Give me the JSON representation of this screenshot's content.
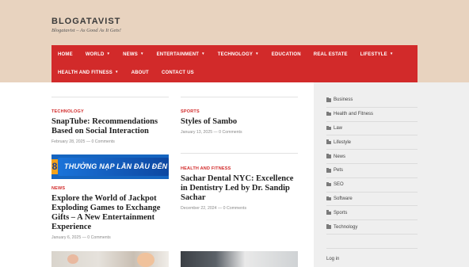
{
  "site": {
    "title": "BLOGATAVIST",
    "tagline": "Blogatavist – As Good As It Gets!"
  },
  "nav": {
    "row1": [
      {
        "label": "HOME",
        "has_dropdown": false
      },
      {
        "label": "WORLD",
        "has_dropdown": true
      },
      {
        "label": "NEWS",
        "has_dropdown": true
      },
      {
        "label": "ENTERTAINMENT",
        "has_dropdown": true
      },
      {
        "label": "TECHNOLOGY",
        "has_dropdown": true
      },
      {
        "label": "EDUCATION",
        "has_dropdown": false
      },
      {
        "label": "REAL ESTATE",
        "has_dropdown": false
      },
      {
        "label": "LIFESTYLE",
        "has_dropdown": true
      }
    ],
    "row2": [
      {
        "label": "HEALTH AND FITNESS",
        "has_dropdown": true
      },
      {
        "label": "ABOUT",
        "has_dropdown": false
      },
      {
        "label": "CONTACT US",
        "has_dropdown": false
      }
    ],
    "caret": "▼",
    "color": "#d22a2a"
  },
  "posts": [
    {
      "category": "TECHNOLOGY",
      "title": "SnapTube: Recommendations Based on Social Interaction",
      "meta": "February 28, 2025 — 0 Comments"
    },
    {
      "category": "SPORTS",
      "title": "Styles of Sambo",
      "meta": "January 13, 2025 — 0 Comments"
    },
    {
      "category": "NEWS",
      "title": "Explore the World of Jackpot Exploding Games to Exchange Gifts – A New Entertainment Experience",
      "meta": "January 6, 2025 — 0 Comments"
    },
    {
      "category": "HEALTH AND FITNESS",
      "title": "Sachar Dental NYC: Excellence in Dentistry Led by Dr. Sandip Sachar",
      "meta": "December 22, 2024 — 0 Comments"
    }
  ],
  "banner": {
    "badge": "8",
    "text": "THƯỞNG NẠP LẦN ĐẦU ĐẾN"
  },
  "sidebar": {
    "categories": [
      "Business",
      "Health and Fitness",
      "Law",
      "Lifestyle",
      "News",
      "Pets",
      "SEO",
      "Software",
      "Sports",
      "Technology"
    ],
    "login": "Log in"
  },
  "colors": {
    "header_bg": "#e8d3bf",
    "accent": "#d22a2a",
    "sidebar_bg": "#efefef"
  }
}
